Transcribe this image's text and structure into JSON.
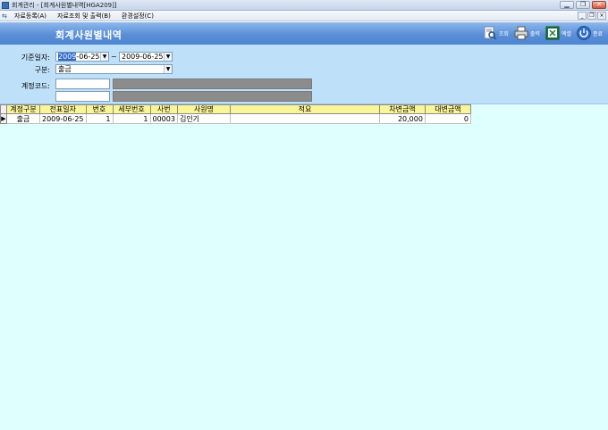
{
  "window": {
    "title": "회계관리 - [회계사원별내역[HGA209]]"
  },
  "menu": {
    "items": [
      "자료등록(A)",
      "자료조회 및 출력(B)",
      "환경설정(C)"
    ]
  },
  "header": {
    "title": "회계사원별내역"
  },
  "toolbar": {
    "query": "조회",
    "print": "출력",
    "excel": "엑셀",
    "exit": "종료"
  },
  "filter": {
    "date_label": "기준일자:",
    "date_from": {
      "sel": "2009",
      "rest": "-06-25"
    },
    "tilde": "~",
    "date_to": "2009-06-25",
    "type_label": "구분:",
    "type_value": "출금",
    "account_label": "계정코드:"
  },
  "grid": {
    "columns": [
      "계정구분",
      "전표일자",
      "번호",
      "세부번호",
      "사번",
      "사원명",
      "적요",
      "차변금액",
      "대변금액"
    ],
    "rows": [
      [
        "출금",
        "2009-06-25",
        "1",
        "1",
        "00003",
        "김인기",
        "",
        "20,000",
        "0"
      ]
    ]
  },
  "colors": {
    "header_bg": "#5a8fd8",
    "filter_bg": "#bfe0f9",
    "grid_bg": "#dffefe",
    "grid_header": "#fbf59a"
  }
}
